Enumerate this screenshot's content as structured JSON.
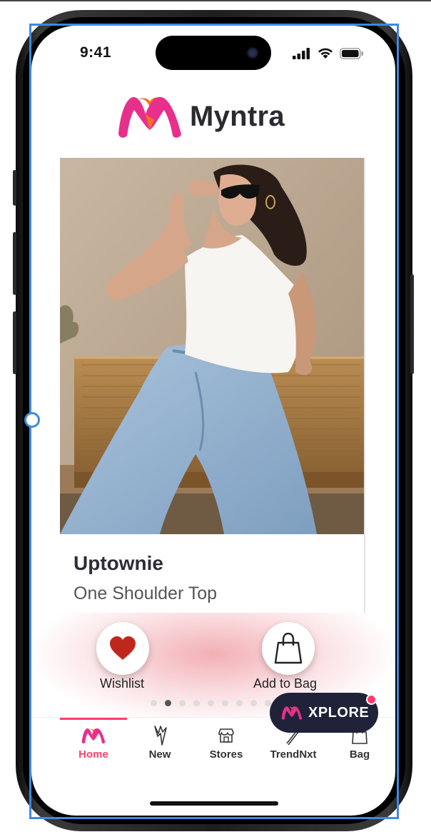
{
  "status_bar": {
    "time": "9:41"
  },
  "brand": {
    "name": "Myntra",
    "colors": {
      "pink": "#e82f8c",
      "orange": "#f36f21",
      "dark": "#2a2a30"
    }
  },
  "product": {
    "brand": "Uptownie",
    "name": "One Shoulder Top"
  },
  "actions": {
    "wishlist_label": "Wishlist",
    "add_to_bag_label": "Add to Bag"
  },
  "carousel": {
    "total": 9,
    "active_index": 1
  },
  "xplore": {
    "label": "XPLORE"
  },
  "tabs": [
    {
      "label": "Home",
      "icon": "myntra-logo-icon",
      "active": true
    },
    {
      "label": "New",
      "icon": "lightning-icon",
      "active": false
    },
    {
      "label": "Stores",
      "icon": "store-icon",
      "active": false
    },
    {
      "label": "TrendNxt",
      "icon": "trend-icon",
      "active": false
    },
    {
      "label": "Bag",
      "icon": "bag-icon",
      "active": false
    }
  ],
  "accent_color": "#ff3f6c"
}
